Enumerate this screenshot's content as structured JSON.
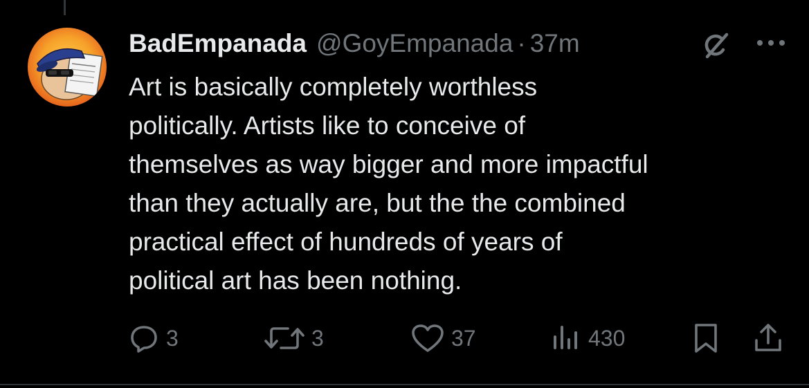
{
  "tweet": {
    "author": {
      "display_name": "BadEmpanada",
      "handle": "@GoyEmpanada",
      "avatar_icon": "avatar-cartoon-news-icon"
    },
    "separator": "·",
    "time": "37m",
    "text": "Art is basically completely worthless\npolitically. Artists like to conceive of\nthemselves as way bigger and more impactful\nthan they actually are, but the the combined\npractical effect of hundreds of years of\npolitical art has been nothing."
  },
  "actions": {
    "replies": "3",
    "reposts": "3",
    "likes": "37",
    "views": "430"
  },
  "icons": {
    "grok": "grok-icon",
    "more": "more-icon",
    "reply": "reply-icon",
    "repost": "repost-icon",
    "like": "heart-icon",
    "views": "views-icon",
    "bookmark": "bookmark-icon",
    "share": "share-icon"
  },
  "colors": {
    "background": "#000000",
    "text_primary": "#e7e9ea",
    "text_secondary": "#71767b",
    "avatar_orange": "#f28a1e"
  }
}
